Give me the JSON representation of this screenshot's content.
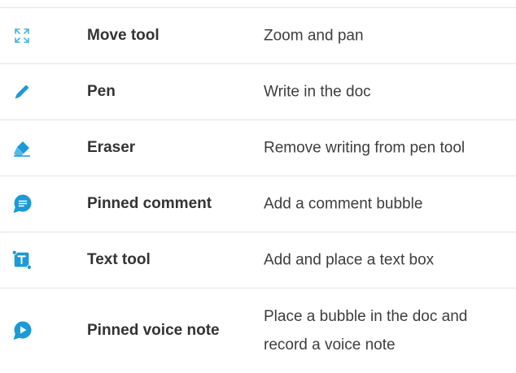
{
  "accent_color": "#1a9ad6",
  "tools": [
    {
      "icon": "move-arrows-icon",
      "name": "Move tool",
      "description": "Zoom and pan"
    },
    {
      "icon": "pen-icon",
      "name": "Pen",
      "description": "Write in the doc"
    },
    {
      "icon": "eraser-icon",
      "name": "Eraser",
      "description": "Remove writing from pen tool"
    },
    {
      "icon": "comment-bubble-icon",
      "name": "Pinned comment",
      "description": "Add a comment bubble"
    },
    {
      "icon": "text-box-icon",
      "name": "Text tool",
      "description": "Add and place a text box"
    },
    {
      "icon": "voice-note-icon",
      "name": "Pinned voice note",
      "description": "Place a bubble in the doc and record a voice note"
    }
  ]
}
